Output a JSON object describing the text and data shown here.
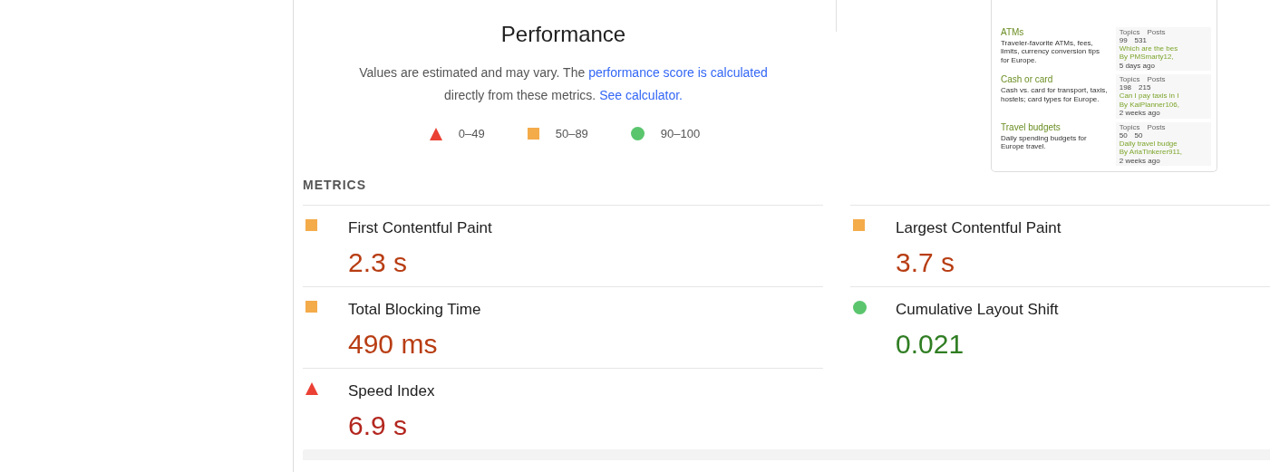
{
  "performance": {
    "title": "Performance",
    "description": [
      {
        "text": "Values are estimated and may vary. The ",
        "kind": "text"
      },
      {
        "text": "performance score is calculated",
        "kind": "link"
      },
      {
        "text": " directly from these metrics. ",
        "kind": "text"
      },
      {
        "text": "See calculator.",
        "kind": "link"
      }
    ]
  },
  "legend": [
    {
      "kind": "fail",
      "label": "0–49"
    },
    {
      "kind": "average",
      "label": "50–89"
    },
    {
      "kind": "pass",
      "label": "90–100"
    }
  ],
  "screenshot": {
    "categories": [
      {
        "title": "ATMs",
        "description": "Traveler-favorite ATMs, fees, limits, currency conversion tips for Europe.",
        "stat_labels": [
          "Topics",
          "Posts"
        ],
        "stats": [
          "99",
          "531"
        ],
        "latest_title": "Which are the bes",
        "latest_by": "By PMSmarty12,",
        "latest_time": "5 days ago"
      },
      {
        "title": "Cash or card",
        "description": "Cash vs. card for transport, taxis, hostels; card types for Europe.",
        "stat_labels": [
          "Topics",
          "Posts"
        ],
        "stats": [
          "198",
          "215"
        ],
        "latest_title": "Can I pay taxis in I",
        "latest_by": "By KaiPlanner106,",
        "latest_time": "2 weeks ago"
      },
      {
        "title": "Travel budgets",
        "description": "Daily spending budgets for Europe travel.",
        "stat_labels": [
          "Topics",
          "Posts"
        ],
        "stats": [
          "50",
          "50"
        ],
        "latest_title": "Daily travel budge",
        "latest_by": "By AriaTinkerer911,",
        "latest_time": "2 weeks ago"
      }
    ]
  },
  "metrics_heading": "METRICS",
  "metrics": [
    {
      "label": "First Contentful Paint",
      "value": "2.3 s",
      "kind": "average"
    },
    {
      "label": "Largest Contentful Paint",
      "value": "3.7 s",
      "kind": "average"
    },
    {
      "label": "Total Blocking Time",
      "value": "490 ms",
      "kind": "average"
    },
    {
      "label": "Cumulative Layout Shift",
      "value": "0.021",
      "kind": "pass"
    },
    {
      "label": "Speed Index",
      "value": "6.9 s",
      "kind": "fail"
    }
  ]
}
